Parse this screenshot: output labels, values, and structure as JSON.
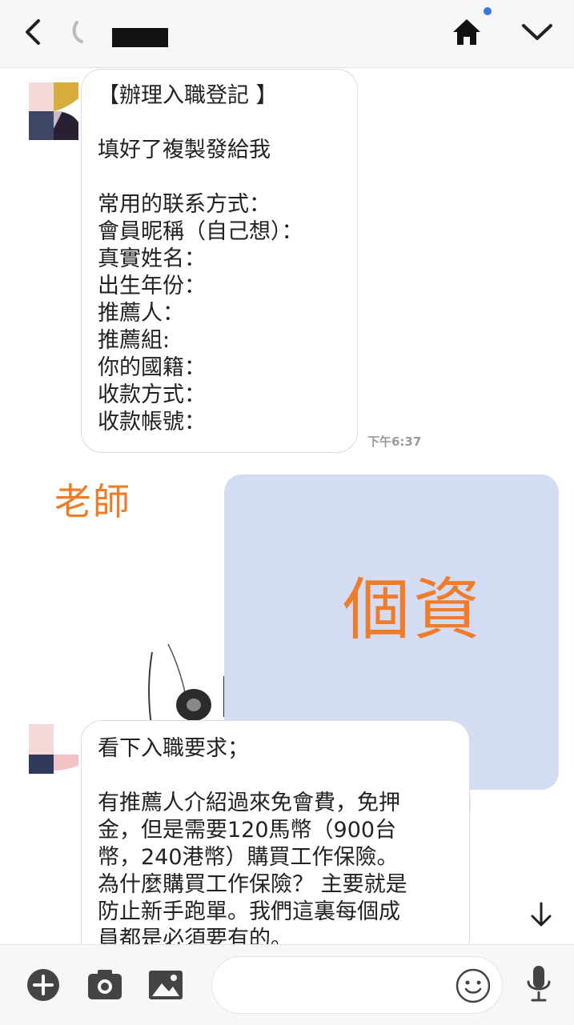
{
  "header": {
    "back_icon": "chevron-left-icon",
    "home_icon": "home-icon",
    "menu_icon": "chevron-down-icon",
    "notification_dot_color": "#3d73e6"
  },
  "messages": [
    {
      "lines": [
        "【辦理入職登記 】",
        "",
        "填好了複製發給我",
        "",
        "常用的联系方式：",
        "會員昵稱（自己想）：",
        "真實姓名：",
        "出生年份：",
        "推薦人：",
        "推薦組:",
        "你的國籍：",
        "收款方式：",
        "收款帳號："
      ],
      "time": "下午6:37"
    },
    {
      "lines": [
        "看下入職要求；",
        "",
        "有推薦人介紹過來免會費，免押",
        "金，但是需要120馬幣（900台",
        "幣，240港幣）購買工作保險。",
        "為什麼購買工作保險？ 主要就是",
        "防止新手跑單。我們這裏每個成",
        "員都是必須要有的。"
      ]
    }
  ],
  "annotations": {
    "teacher": "老師",
    "personal_info": "個資",
    "color": "#f07b28"
  },
  "input_bar": {
    "placeholder": "",
    "icons": [
      "plus-icon",
      "camera-icon",
      "image-icon",
      "emoji-icon",
      "microphone-icon"
    ]
  }
}
